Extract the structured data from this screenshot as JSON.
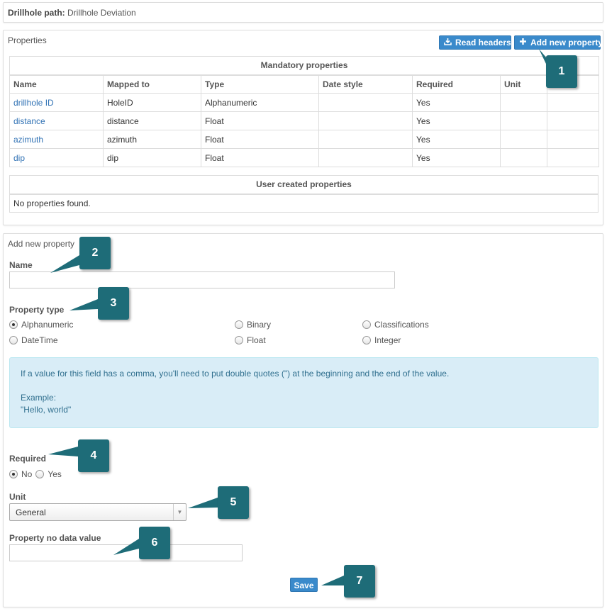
{
  "path_bar": {
    "label": "Drillhole path:",
    "value": "Drillhole Deviation"
  },
  "properties_panel": {
    "title": "Properties",
    "read_headers_label": "Read headers",
    "add_new_property_label": "Add new property",
    "mandatory": {
      "caption": "Mandatory properties",
      "columns": [
        "Name",
        "Mapped to",
        "Type",
        "Date style",
        "Required",
        "Unit",
        ""
      ],
      "rows": [
        [
          "drillhole ID",
          "HoleID",
          "Alphanumeric",
          "",
          "Yes",
          "",
          ""
        ],
        [
          "distance",
          "distance",
          "Float",
          "",
          "Yes",
          "",
          ""
        ],
        [
          "azimuth",
          "azimuth",
          "Float",
          "",
          "Yes",
          "",
          ""
        ],
        [
          "dip",
          "dip",
          "Float",
          "",
          "Yes",
          "",
          ""
        ]
      ]
    },
    "user_created": {
      "caption": "User created properties",
      "empty_text": "No properties found."
    }
  },
  "add_panel": {
    "title": "Add new property",
    "name_label": "Name",
    "name_value": "",
    "property_type_label": "Property type",
    "property_types": [
      {
        "label": "Alphanumeric",
        "checked": true
      },
      {
        "label": "Binary",
        "checked": false
      },
      {
        "label": "Classifications",
        "checked": false
      },
      {
        "label": "DateTime",
        "checked": false
      },
      {
        "label": "Float",
        "checked": false
      },
      {
        "label": "Integer",
        "checked": false
      }
    ],
    "info": {
      "text": "If a value for this field has a comma, you'll need to put double quotes (\") at the beginning and the end of the value.",
      "example_label": "Example:",
      "example_value": "\"Hello, world\""
    },
    "required_label": "Required",
    "required_no": "No",
    "required_yes": "Yes",
    "required_value": "No",
    "unit_label": "Unit",
    "unit_value": "General",
    "no_data_label": "Property no data value",
    "no_data_value": "",
    "save_label": "Save"
  },
  "callouts": [
    "1",
    "2",
    "3",
    "4",
    "5",
    "6",
    "7"
  ],
  "colors": {
    "accent": "#3a8acb",
    "callout": "#1e6c78",
    "info_bg": "#d9edf7",
    "link": "#3273b5"
  },
  "icons": {
    "read_headers": "import-icon",
    "add_property": "plus-icon",
    "select": "chevron-down-icon"
  }
}
